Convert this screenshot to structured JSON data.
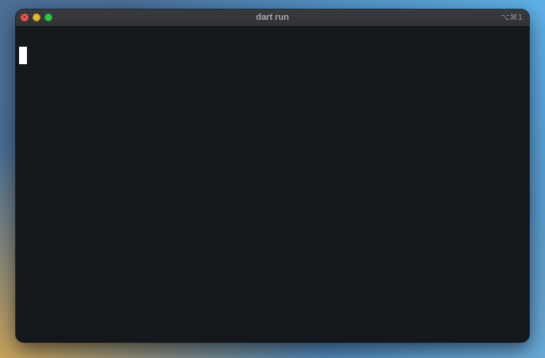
{
  "window": {
    "title": "dart run",
    "shortcut": "⌥⌘1"
  },
  "titlebar": {
    "close_glyph": "×"
  },
  "colors": {
    "terminal_background": "#14171b",
    "cursor": "#ffffff",
    "close_light": "#ec5f57",
    "minimize_light": "#e2b53d",
    "maximize_light": "#31c447"
  },
  "icons": {
    "close": "close-icon",
    "minimize": "minimize-icon",
    "maximize": "maximize-icon"
  }
}
